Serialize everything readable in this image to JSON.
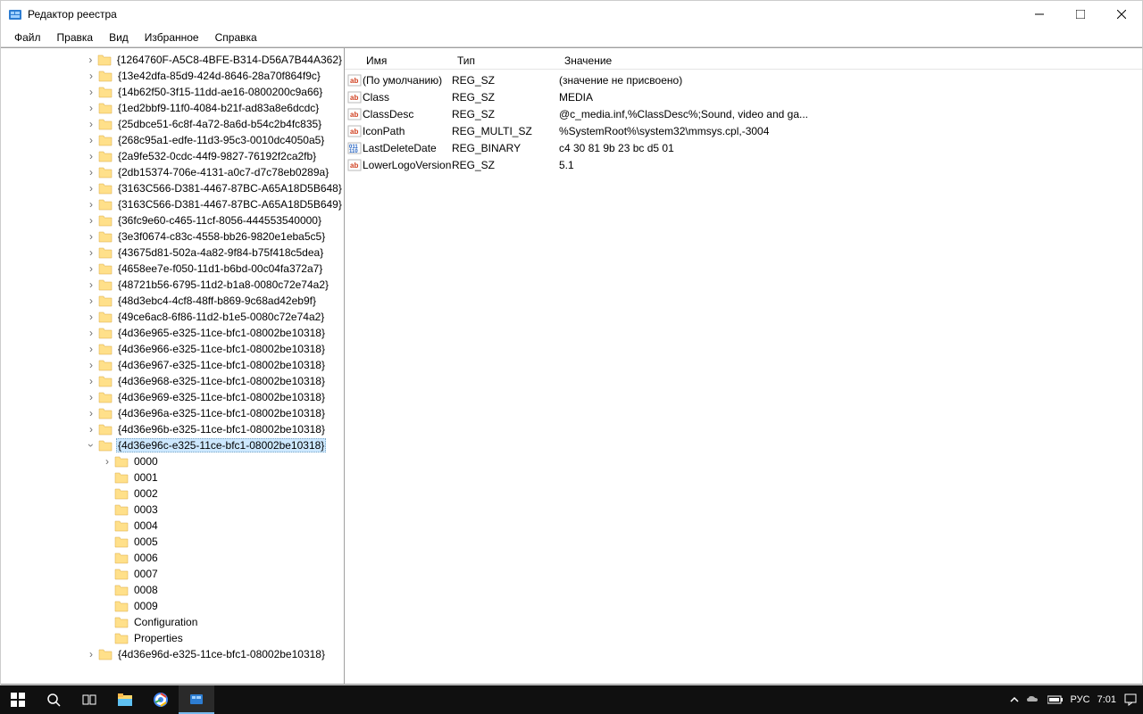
{
  "window": {
    "title": "Редактор реестра"
  },
  "menu": {
    "file": "Файл",
    "edit": "Правка",
    "view": "Вид",
    "favorites": "Избранное",
    "help": "Справка"
  },
  "tree": {
    "folders": [
      "{1264760F-A5C8-4BFE-B314-D56A7B44A362}",
      "{13e42dfa-85d9-424d-8646-28a70f864f9c}",
      "{14b62f50-3f15-11dd-ae16-0800200c9a66}",
      "{1ed2bbf9-11f0-4084-b21f-ad83a8e6dcdc}",
      "{25dbce51-6c8f-4a72-8a6d-b54c2b4fc835}",
      "{268c95a1-edfe-11d3-95c3-0010dc4050a5}",
      "{2a9fe532-0cdc-44f9-9827-76192f2ca2fb}",
      "{2db15374-706e-4131-a0c7-d7c78eb0289a}",
      "{3163C566-D381-4467-87BC-A65A18D5B648}",
      "{3163C566-D381-4467-87BC-A65A18D5B649}",
      "{36fc9e60-c465-11cf-8056-444553540000}",
      "{3e3f0674-c83c-4558-bb26-9820e1eba5c5}",
      "{43675d81-502a-4a82-9f84-b75f418c5dea}",
      "{4658ee7e-f050-11d1-b6bd-00c04fa372a7}",
      "{48721b56-6795-11d2-b1a8-0080c72e74a2}",
      "{48d3ebc4-4cf8-48ff-b869-9c68ad42eb9f}",
      "{49ce6ac8-6f86-11d2-b1e5-0080c72e74a2}",
      "{4d36e965-e325-11ce-bfc1-08002be10318}",
      "{4d36e966-e325-11ce-bfc1-08002be10318}",
      "{4d36e967-e325-11ce-bfc1-08002be10318}",
      "{4d36e968-e325-11ce-bfc1-08002be10318}",
      "{4d36e969-e325-11ce-bfc1-08002be10318}",
      "{4d36e96a-e325-11ce-bfc1-08002be10318}",
      "{4d36e96b-e325-11ce-bfc1-08002be10318}"
    ],
    "selected": "{4d36e96c-e325-11ce-bfc1-08002be10318}",
    "children": [
      "0000",
      "0001",
      "0002",
      "0003",
      "0004",
      "0005",
      "0006",
      "0007",
      "0008",
      "0009",
      "Configuration",
      "Properties"
    ],
    "after": "{4d36e96d-e325-11ce-bfc1-08002be10318}"
  },
  "values": {
    "headers": {
      "name": "Имя",
      "type": "Тип",
      "data": "Значение"
    },
    "rows": [
      {
        "icon": "sz",
        "name": "(По умолчанию)",
        "type": "REG_SZ",
        "data": "(значение не присвоено)"
      },
      {
        "icon": "sz",
        "name": "Class",
        "type": "REG_SZ",
        "data": "MEDIA"
      },
      {
        "icon": "sz",
        "name": "ClassDesc",
        "type": "REG_SZ",
        "data": "@c_media.inf,%ClassDesc%;Sound, video and ga..."
      },
      {
        "icon": "sz",
        "name": "IconPath",
        "type": "REG_MULTI_SZ",
        "data": "%SystemRoot%\\system32\\mmsys.cpl,-3004"
      },
      {
        "icon": "bin",
        "name": "LastDeleteDate",
        "type": "REG_BINARY",
        "data": "c4 30 81 9b 23 bc d5 01"
      },
      {
        "icon": "sz",
        "name": "LowerLogoVersion",
        "type": "REG_SZ",
        "data": "5.1"
      }
    ]
  },
  "taskbar": {
    "lang": "РУС",
    "time": "7:01"
  }
}
